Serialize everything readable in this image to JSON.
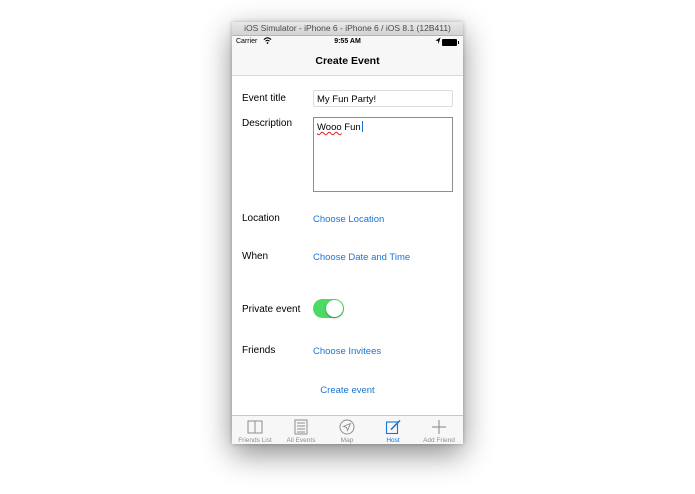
{
  "window": {
    "title": "iOS Simulator - iPhone 6 - iPhone 6 / iOS 8.1 (12B411)"
  },
  "status_bar": {
    "carrier": "Carrier",
    "time": "9:55 AM"
  },
  "nav": {
    "title": "Create Event"
  },
  "form": {
    "event_title_label": "Event title",
    "event_title_value": "My Fun Party!",
    "description_label": "Description",
    "description_word1": "Wooo",
    "description_word2": " Fun",
    "location_label": "Location",
    "location_link": "Choose Location",
    "when_label": "When",
    "when_link": "Choose Date and Time",
    "private_label": "Private event",
    "private_on": true,
    "friends_label": "Friends",
    "friends_link": "Choose Invitees",
    "create_button": "Create event"
  },
  "colors": {
    "accent": "#1a74d6",
    "toggle_on": "#4cd964",
    "tab_inactive": "#8e8e8e"
  },
  "tabs": [
    {
      "label": "Friends List",
      "icon": "book-icon",
      "active": false
    },
    {
      "label": "All Events",
      "icon": "list-icon",
      "active": false
    },
    {
      "label": "Map",
      "icon": "location-arrow-icon",
      "active": false
    },
    {
      "label": "Host",
      "icon": "compose-icon",
      "active": true
    },
    {
      "label": "Add Friend",
      "icon": "plus-icon",
      "active": false
    }
  ]
}
